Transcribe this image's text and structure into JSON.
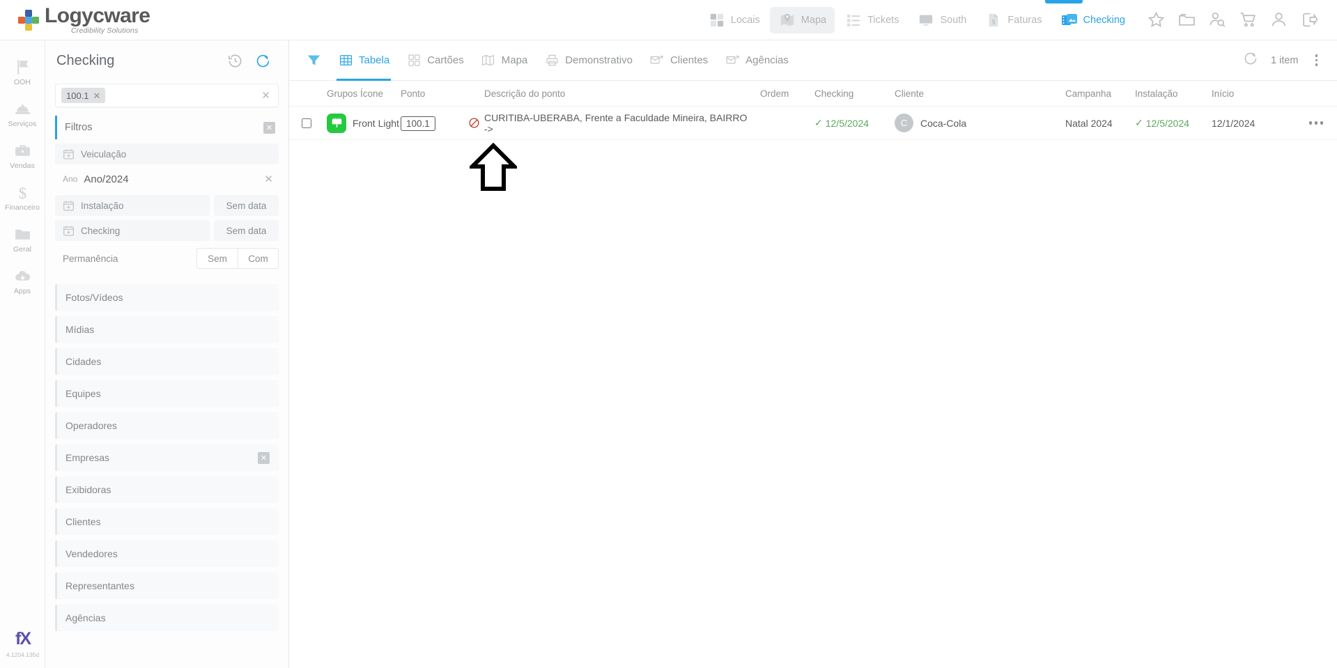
{
  "brand": {
    "name": "Logycware",
    "tagline": "Credibility Solutions",
    "accent": "#29a3e8"
  },
  "topnav": {
    "items": [
      {
        "label": "Locais",
        "icon": "grid-squares-icon",
        "state": "default"
      },
      {
        "label": "Mapa",
        "icon": "map-pin-icon",
        "state": "selected"
      },
      {
        "label": "Tickets",
        "icon": "checklist-icon",
        "state": "default"
      },
      {
        "label": "South",
        "icon": "monitor-icon",
        "state": "default"
      },
      {
        "label": "Faturas",
        "icon": "invoice-dollar-icon",
        "state": "default"
      },
      {
        "label": "Checking",
        "icon": "photo-stack-icon",
        "state": "active"
      }
    ],
    "actions": [
      {
        "icon": "star-icon"
      },
      {
        "icon": "folder-icon"
      },
      {
        "icon": "user-search-icon"
      },
      {
        "icon": "shopping-cart-icon"
      },
      {
        "icon": "user-icon"
      },
      {
        "icon": "logout-icon"
      }
    ]
  },
  "rail": {
    "items": [
      {
        "label": "OOH",
        "icon": "flag-icon"
      },
      {
        "label": "Serviços",
        "icon": "hardhat-icon"
      },
      {
        "label": "Vendas",
        "icon": "briefcase-icon"
      },
      {
        "label": "Financeiro",
        "icon": "dollar-icon"
      },
      {
        "label": "Geral",
        "icon": "folder-icon"
      },
      {
        "label": "Apps",
        "icon": "cloud-plus-icon"
      }
    ],
    "footer_logo": "fX",
    "version": "4.1204.135d"
  },
  "panel": {
    "title": "Checking",
    "history_icon": "history-icon",
    "refresh_icon": "refresh-icon",
    "search": {
      "chip": "100.1",
      "chip_remove": "✕",
      "clear": "✕",
      "placeholder": ""
    },
    "filters": {
      "title": "Filtros",
      "close": "✕",
      "veiculacao": {
        "label": "Veiculação",
        "icon": "calendar-plus-icon"
      },
      "ano": {
        "tag": "Ano",
        "value": "Ano/2024",
        "clear": "✕"
      },
      "instalacao": {
        "label": "Instalação",
        "icon": "calendar-plus-icon",
        "value": "Sem data"
      },
      "checking": {
        "label": "Checking",
        "icon": "calendar-plus-icon",
        "value": "Sem data"
      },
      "permanencia": {
        "label": "Permanência",
        "options": [
          "Sem",
          "Com"
        ]
      }
    },
    "sections": [
      {
        "label": "Fotos/Vídeos",
        "has_clear": false
      },
      {
        "label": "Mídias",
        "has_clear": false
      },
      {
        "label": "Cidades",
        "has_clear": false
      },
      {
        "label": "Equipes",
        "has_clear": false
      },
      {
        "label": "Operadores",
        "has_clear": false
      },
      {
        "label": "Empresas",
        "has_clear": true
      },
      {
        "label": "Exibidoras",
        "has_clear": false
      },
      {
        "label": "Clientes",
        "has_clear": false
      },
      {
        "label": "Vendedores",
        "has_clear": false
      },
      {
        "label": "Representantes",
        "has_clear": false
      },
      {
        "label": "Agências",
        "has_clear": false
      }
    ]
  },
  "toolbar": {
    "filter_icon": "funnel-icon",
    "tabs": [
      {
        "label": "Tabela",
        "icon": "table-icon",
        "active": true
      },
      {
        "label": "Cartões",
        "icon": "cards-icon",
        "active": false
      },
      {
        "label": "Mapa",
        "icon": "map-icon",
        "active": false
      },
      {
        "label": "Demonstrativo",
        "icon": "printer-icon",
        "active": false
      },
      {
        "label": "Clientes",
        "icon": "send-mail-icon",
        "active": false
      },
      {
        "label": "Agências",
        "icon": "send-mail-icon",
        "active": false
      }
    ],
    "refresh_icon": "refresh-icon",
    "item_count": "1 item",
    "menu_icon": "vertical-dots-icon"
  },
  "table": {
    "columns": [
      "Grupos Ícone",
      "Ponto",
      "Descrição do ponto",
      "Ordem",
      "Checking",
      "Cliente",
      "Campanha",
      "Instalação",
      "Início"
    ],
    "rows": [
      {
        "selected": false,
        "grupo_icon": "billboard-icon",
        "grupo_color": "#25c93f",
        "grupo": "Front Light",
        "ponto": "100.1",
        "status_icon": "prohibited-icon",
        "status_color": "#c0392b",
        "descricao": "CURITIBA-UBERABA, Frente a Faculdade Mineira, BAIRRO ->",
        "ordem": "",
        "checking": "12/5/2024",
        "checking_ok": true,
        "cliente_initial": "C",
        "cliente": "Coca-Cola",
        "campanha": "Natal 2024",
        "instalacao": "12/5/2024",
        "instalacao_ok": true,
        "inicio": "12/1/2024",
        "more": "•••"
      }
    ]
  },
  "annotation": {
    "shape": "up-arrow-outline",
    "color": "#000000"
  }
}
